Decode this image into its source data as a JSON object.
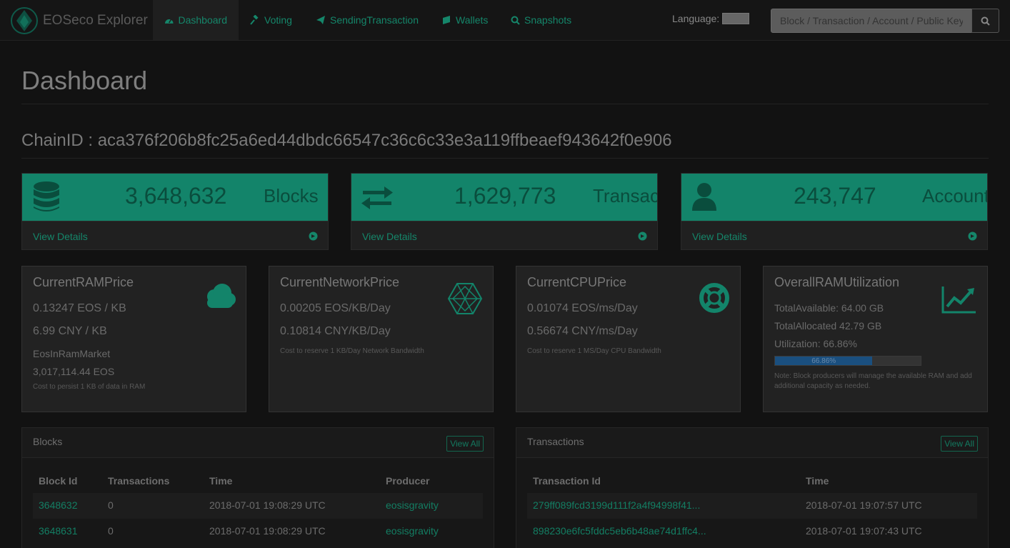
{
  "app": {
    "title": "EOSeco Explorer"
  },
  "nav": {
    "items": [
      {
        "label": "Dashboard",
        "icon": "dashboard-icon"
      },
      {
        "label": "Voting",
        "icon": "gavel-icon"
      },
      {
        "label": "SendingTransaction",
        "icon": "paper-plane-icon"
      },
      {
        "label": "Wallets",
        "icon": "wallet-icon"
      },
      {
        "label": "Snapshots",
        "icon": "search-icon"
      }
    ],
    "active": "Dashboard"
  },
  "language": {
    "label": "Language:",
    "value": ""
  },
  "search": {
    "placeholder": "Block / Transaction / Account / Public Key"
  },
  "page": {
    "title": "Dashboard",
    "chain_id": "ChainID : aca376f206b8fc25a6ed44dbdc66547c36c6c33e3a119ffbeaef943642f0e906"
  },
  "stats": [
    {
      "value": "3,648,632",
      "label": "Blocks",
      "link": "View Details",
      "icon": "database-icon"
    },
    {
      "value": "1,629,773",
      "label": "Transactions",
      "link": "View Details",
      "icon": "exchange-icon"
    },
    {
      "value": "243,747",
      "label": "Accounts",
      "link": "View Details",
      "icon": "user-icon"
    }
  ],
  "ram": {
    "title": "CurrentRAMPrice",
    "price_eos": "0.13247 EOS / KB",
    "price_cny": "6.99 CNY / KB",
    "market_label": "EosInRamMarket",
    "market_value": "3,017,114.44 EOS",
    "note": "Cost to persist 1 KB of data in RAM",
    "icon": "cloud-icon"
  },
  "network": {
    "title": "CurrentNetworkPrice",
    "price_eos": "0.00205 EOS/KB/Day",
    "price_cny": "0.10814 CNY/KB/Day",
    "note": "Cost to reserve 1 KB/Day Network Bandwidth",
    "icon": "network-icon"
  },
  "cpu": {
    "title": "CurrentCPUPrice",
    "price_eos": "0.01074 EOS/ms/Day",
    "price_cny": "0.56674 CNY/ms/Day",
    "note": "Cost to reserve 1 MS/Day CPU Bandwidth",
    "icon": "life-ring-icon"
  },
  "utilization": {
    "title": "OverallRAMUtilization",
    "available": "TotalAvailable: 64.00 GB",
    "allocated": "TotalAllocated 42.79 GB",
    "utilization": "Utilization: 66.86%",
    "progress_label": "66.86%",
    "progress_fraction": 0.6686,
    "note": "Note: Block producers will manage the available RAM and add additional capacity as needed.",
    "icon": "line-chart-icon"
  },
  "blocks": {
    "title": "Blocks",
    "view_all": "View All",
    "columns": [
      "Block Id",
      "Transactions",
      "Time",
      "Producer"
    ],
    "rows": [
      [
        "3648632",
        "0",
        "2018-07-01 19:08:29 UTC",
        "eosisgravity"
      ],
      [
        "3648631",
        "0",
        "2018-07-01 19:08:29 UTC",
        "eosisgravity"
      ]
    ]
  },
  "transactions": {
    "title": "Transactions",
    "view_all": "View All",
    "columns": [
      "Transaction Id",
      "Time"
    ],
    "rows": [
      [
        "279ff089fcd3199d111f2a4f94998f41...",
        "2018-07-01 19:07:57 UTC"
      ],
      [
        "898230e6fc5fddc5eb6b48ae74d1ffc4...",
        "2018-07-01 19:07:43 UTC"
      ]
    ]
  },
  "colors": {
    "accent": "#13846a",
    "link": "#15866a",
    "background": "#121212",
    "progress": "#1a4f7f"
  }
}
